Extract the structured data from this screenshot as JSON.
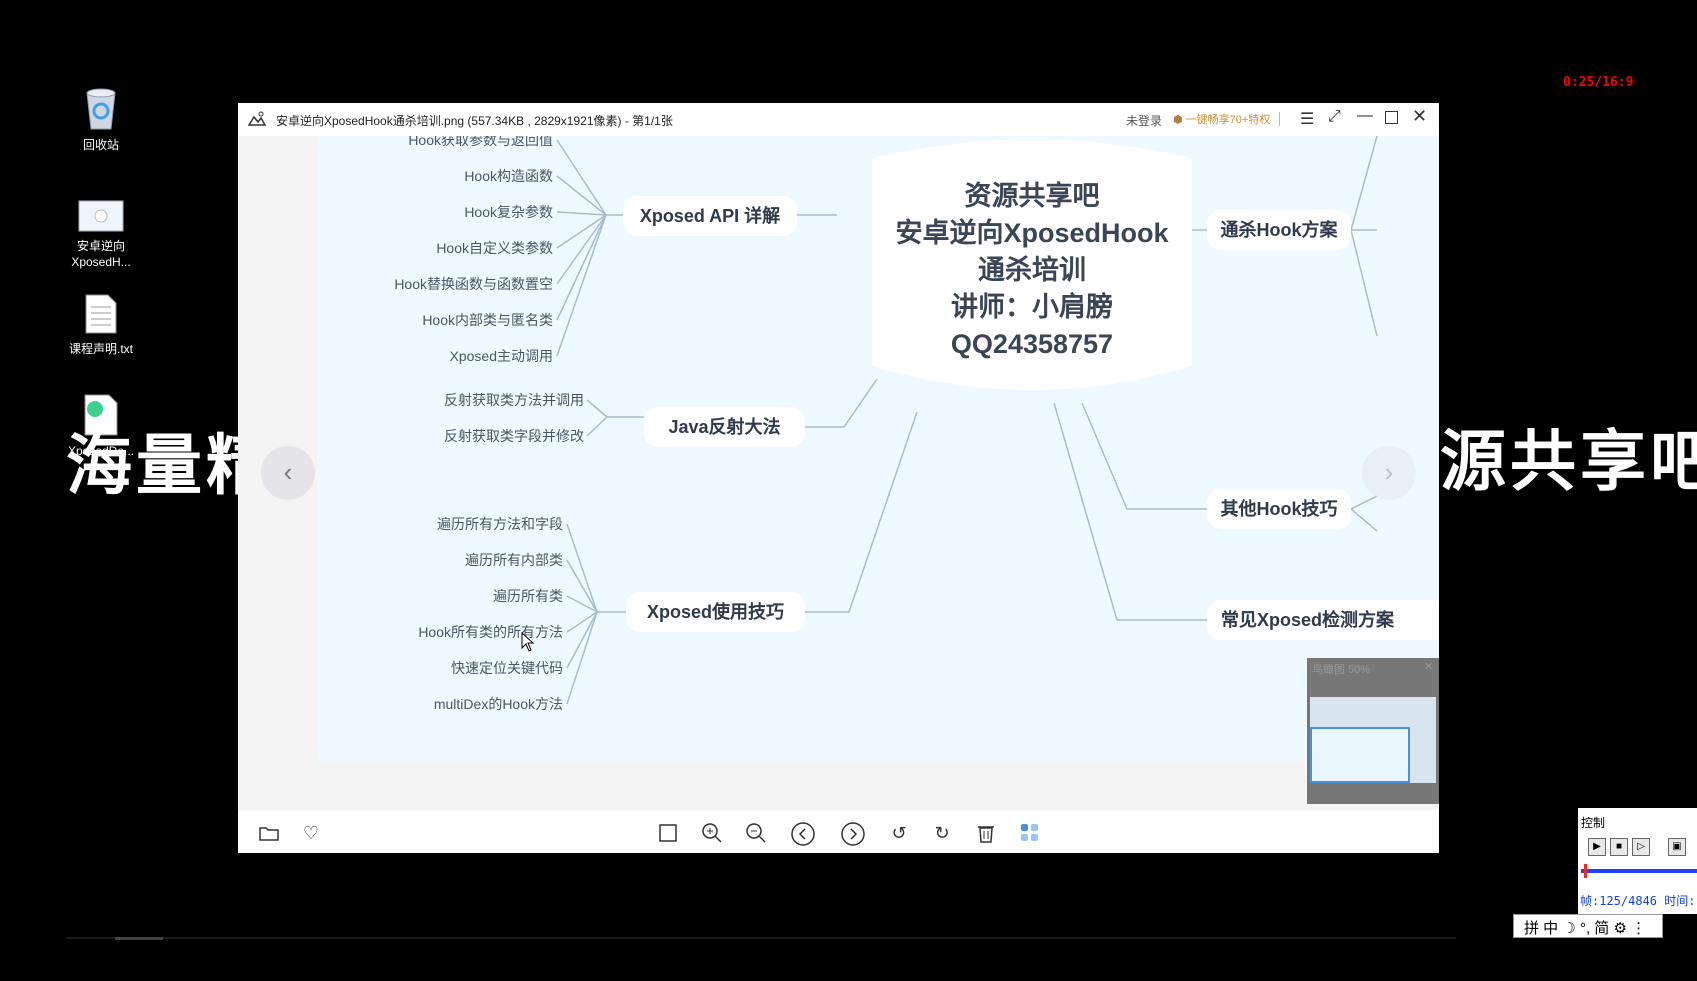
{
  "desktop": {
    "icons": [
      {
        "name": "recycle-bin",
        "label": "回收站"
      },
      {
        "name": "image-file",
        "label": "安卓逆向\nXposedH..."
      },
      {
        "name": "txt-file",
        "label": "课程声明.txt"
      },
      {
        "name": "apk-file",
        "label": "XposedDe..."
      }
    ],
    "overlay_left": "海量精",
    "overlay_right": "源共享吧",
    "timer": "0:25/16:9"
  },
  "viewer": {
    "title": "安卓逆向XposedHook通杀培训.png (557.34KB , 2829x1921像素) - 第1/1张",
    "login": "未登录",
    "promo": "一键畅享70+特权",
    "minimap_label": "鸟瞰图 50%"
  },
  "mindmap": {
    "center": [
      "资源共享吧",
      "安卓逆向XposedHook",
      "通杀培训",
      "讲师：小肩膀",
      "QQ24358757"
    ],
    "branches": {
      "api": "Xposed API 详解",
      "reflect": "Java反射大法",
      "tips": "Xposed使用技巧",
      "kill": "通杀Hook方案",
      "other": "其他Hook技巧",
      "detect": "常见Xposed检测方案"
    },
    "api_leaves": [
      "Hook获取参数与返回值",
      "Hook构造函数",
      "Hook复杂参数",
      "Hook自定义类参数",
      "Hook替换函数与函数置空",
      "Hook内部类与匿名类",
      "Xposed主动调用"
    ],
    "reflect_leaves": [
      "反射获取类方法并调用",
      "反射获取类字段并修改"
    ],
    "tips_leaves": [
      "遍历所有方法和字段",
      "遍历所有内部类",
      "遍历所有类",
      "Hook所有类的所有方法",
      "快速定位关键代码",
      "multiDex的Hook方法"
    ]
  },
  "control_panel": {
    "title": "控制",
    "status": "帧:125/4846 时间:"
  },
  "ime": {
    "text": "拼 中 ☽ °, 简 ⚙ ⋮"
  },
  "colors": {
    "map_bg": "#eefaff",
    "line": "#9fb3c4",
    "timer": "#ff0000"
  }
}
